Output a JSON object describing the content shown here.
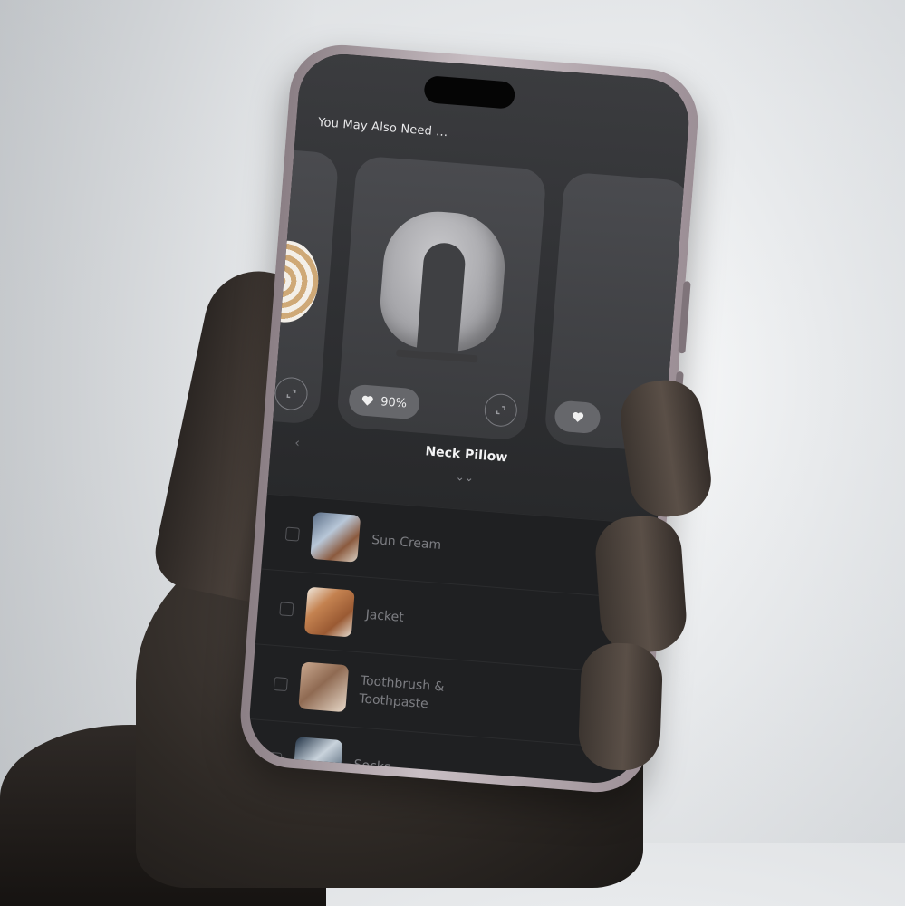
{
  "screen": {
    "section_title": "You May Also Need ...",
    "featured": {
      "name": "Neck Pillow",
      "like_percent": "90%"
    },
    "nav": {
      "prev_symbol": "‹",
      "next_symbol": "›",
      "expand_symbol": "⌄⌄"
    },
    "checklist": [
      {
        "label": "Sun Cream",
        "checked": false
      },
      {
        "label": "Jacket",
        "checked": false
      },
      {
        "label": "Toothbrush &\nToothpaste",
        "checked": false
      },
      {
        "label": "Socks",
        "checked": false
      }
    ]
  },
  "icons": {
    "like": "heart-icon",
    "expand": "expand-icon",
    "prev": "chevron-left-icon",
    "next": "chevron-right-icon",
    "more": "double-chevron-down-icon"
  },
  "colors": {
    "screen_bg": "#1f2022",
    "card_bg": "#4a4b4f",
    "pill_bg": "#66676b",
    "text_primary": "#f4f4f5",
    "text_muted": "#7c7d82"
  }
}
